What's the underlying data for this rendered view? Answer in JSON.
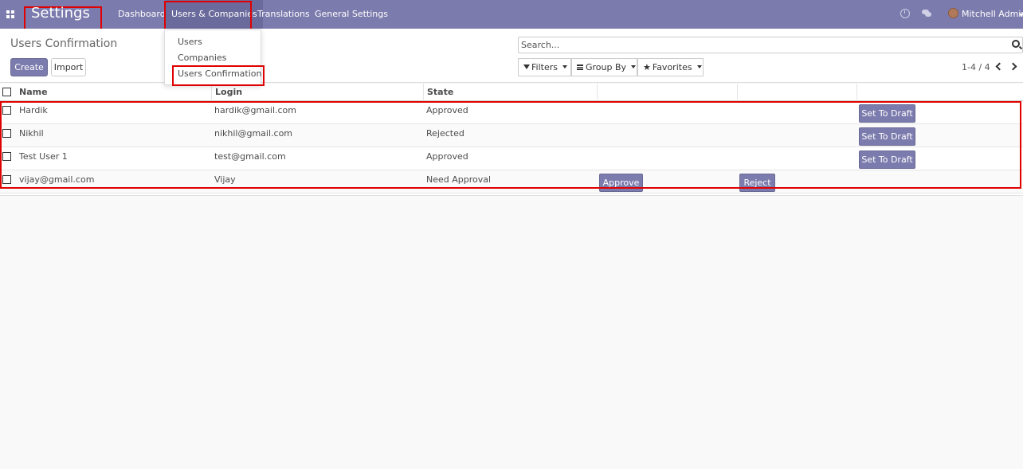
{
  "navbar": {
    "brand": "Settings",
    "menu": [
      {
        "label": "Dashboard"
      },
      {
        "label": "Users & Companies"
      },
      {
        "label": "Translations"
      },
      {
        "label": "General Settings"
      }
    ],
    "user": "Mitchell Admin"
  },
  "dropdown": {
    "items": [
      {
        "label": "Users"
      },
      {
        "label": "Companies"
      },
      {
        "label": "Users Confirmation"
      }
    ]
  },
  "control_panel": {
    "title": "Users Confirmation",
    "create_label": "Create",
    "import_label": "Import",
    "search_placeholder": "Search...",
    "filters_label": "Filters",
    "groupby_label": "Group By",
    "favorites_label": "Favorites",
    "pager": "1-4 / 4"
  },
  "table": {
    "columns": [
      "Name",
      "Login",
      "State"
    ],
    "rows": [
      {
        "name": "Hardik",
        "login": "hardik@gmail.com",
        "state": "Approved",
        "action": "Set To Draft"
      },
      {
        "name": "Nikhil",
        "login": "nikhil@gmail.com",
        "state": "Rejected",
        "action": "Set To Draft"
      },
      {
        "name": "Test User 1",
        "login": "test@gmail.com",
        "state": "Approved",
        "action": "Set To Draft"
      },
      {
        "name": "vijay@gmail.com",
        "login": "Vijay",
        "state": "Need Approval",
        "approve": "Approve",
        "reject": "Reject"
      }
    ]
  },
  "colors": {
    "primary": "#7c7bad",
    "highlight": "#e00000"
  }
}
